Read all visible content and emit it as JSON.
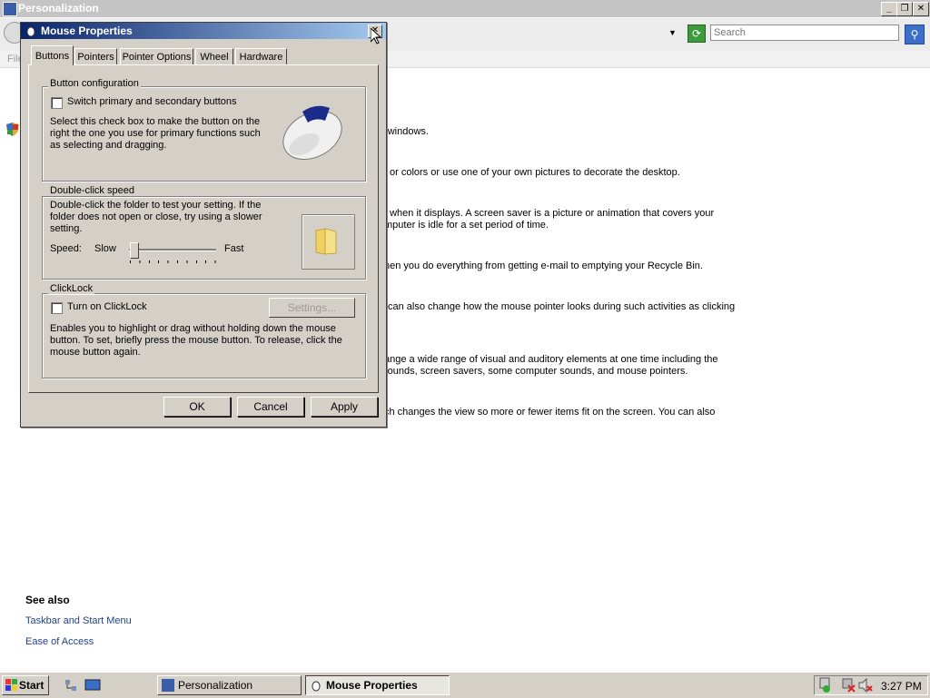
{
  "personalization": {
    "title": "Personalization",
    "search_placeholder": "Search",
    "menu_file": "File",
    "descriptions": [
      "r windows.",
      "or colors or use one of your own pictures to decorate the desktop.",
      "t when it displays. A screen saver is a picture or animation that covers your",
      "mputer is idle for a set period of time.",
      "hen you do everything from getting e-mail to emptying your Recycle Bin.",
      "can also change how the mouse pointer looks during such activities as clicking",
      "ange a wide range of visual and auditory elements at one time including the",
      "rounds, screen savers, some computer sounds, and mouse pointers.",
      "ch changes the view so more or fewer items fit on the screen. You can also"
    ],
    "see_also": {
      "heading": "See also",
      "links": [
        "Taskbar and Start Menu",
        "Ease of Access"
      ]
    }
  },
  "dialog": {
    "title": "Mouse Properties",
    "tabs": [
      "Buttons",
      "Pointers",
      "Pointer Options",
      "Wheel",
      "Hardware"
    ],
    "active_tab": "Buttons",
    "button_config": {
      "legend": "Button configuration",
      "switch_label": "Switch primary and secondary buttons",
      "switch_checked": false,
      "description": [
        "Select this check box to make the button on the",
        "right the one you use for primary functions such",
        "as selecting and dragging."
      ]
    },
    "double_click": {
      "legend": "Double-click speed",
      "description": [
        "Double-click the folder to test your setting. If the",
        "folder does not open or close, try using a slower",
        "setting."
      ],
      "speed_label": "Speed:",
      "slow_label": "Slow",
      "fast_label": "Fast",
      "slider_value": 0.05
    },
    "clicklock": {
      "legend": "ClickLock",
      "turn_on_label": "Turn on ClickLock",
      "turn_on_checked": false,
      "settings_label": "Settings...",
      "description": [
        "Enables you to highlight or drag without holding down the mouse",
        "button. To set, briefly press the mouse button. To release, click the",
        "mouse button again."
      ]
    },
    "buttons": {
      "ok": "OK",
      "cancel": "Cancel",
      "apply": "Apply"
    }
  },
  "taskbar": {
    "start": "Start",
    "items": [
      "Personalization",
      "Mouse Properties"
    ],
    "active_item": "Mouse Properties",
    "clock": "3:27 PM"
  }
}
